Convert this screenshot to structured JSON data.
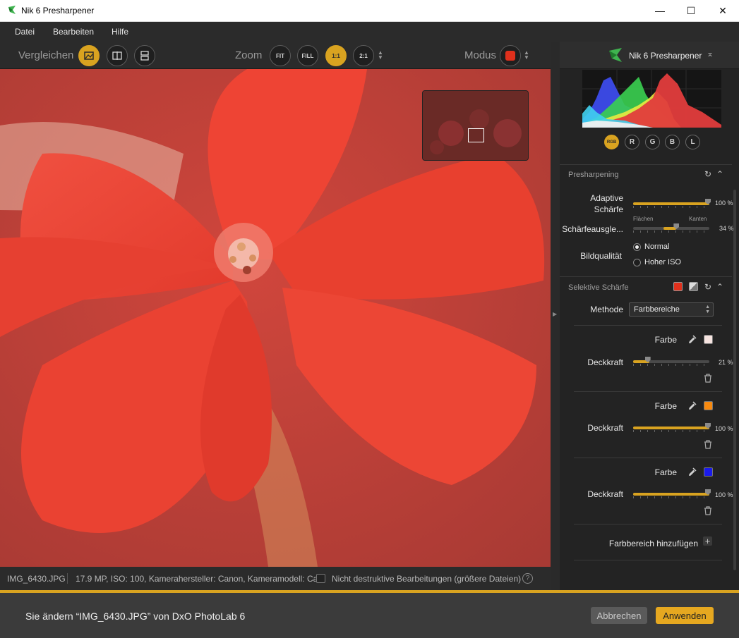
{
  "window": {
    "title": "Nik 6 Presharpener",
    "minimize_glyph": "—",
    "maximize_glyph": "☐",
    "close_glyph": "✕"
  },
  "menu": [
    "Datei",
    "Bearbeiten",
    "Hilfe"
  ],
  "toolbar": {
    "compare_label": "Vergleichen",
    "zoom_label": "Zoom",
    "zoom_fit": "FIT",
    "zoom_fill": "FILL",
    "zoom_1_1": "1:1",
    "zoom_2_1": "2:1",
    "mode_label": "Modus",
    "mode_color": "#e0301c"
  },
  "status": {
    "filename": "IMG_6430.JPG",
    "info": "17.9 MP, ISO: 100, Kamerahersteller: Canon, Kameramodell: Ca...",
    "non_destructive": "Nicht destruktive Bearbeitungen (größere Dateien)",
    "help": "?"
  },
  "panel": {
    "title": "Nik 6 Presharpener",
    "channels": [
      "RGB",
      "R",
      "G",
      "B",
      "L"
    ],
    "presharpening": {
      "title": "Presharpening",
      "adaptive_label_1": "Adaptive",
      "adaptive_label_2": "Schärfe",
      "adaptive_value": "100 %",
      "adaptive_level": 1.0,
      "balance_label": "Schärfeausgle...",
      "balance_left": "Flächen",
      "balance_right": "Kanten",
      "balance_value": "34 %",
      "balance_level": 0.34,
      "quality_label": "Bildqualität",
      "quality_options": [
        "Normal",
        "Hoher ISO"
      ],
      "quality_selected": "Normal"
    },
    "selective": {
      "title": "Selektive Schärfe",
      "method_label": "Methode",
      "method_value": "Farbbereiche",
      "ranges": [
        {
          "color_label": "Farbe",
          "color": "#f6e4e0",
          "opacity_label": "Deckkraft",
          "opacity_value": "21 %",
          "opacity_level": 0.21
        },
        {
          "color_label": "Farbe",
          "color": "#f7890f",
          "opacity_label": "Deckkraft",
          "opacity_value": "100 %",
          "opacity_level": 1.0
        },
        {
          "color_label": "Farbe",
          "color": "#1a1aeb",
          "opacity_label": "Deckkraft",
          "opacity_value": "100 %",
          "opacity_level": 1.0
        }
      ],
      "add_range": "Farbbereich hinzufügen"
    }
  },
  "bottom": {
    "message": "Sie ändern “IMG_6430.JPG” von DxO PhotoLab 6",
    "cancel": "Abbrechen",
    "apply": "Anwenden"
  },
  "colors": {
    "accent": "#d9a320",
    "background": "#232323"
  }
}
